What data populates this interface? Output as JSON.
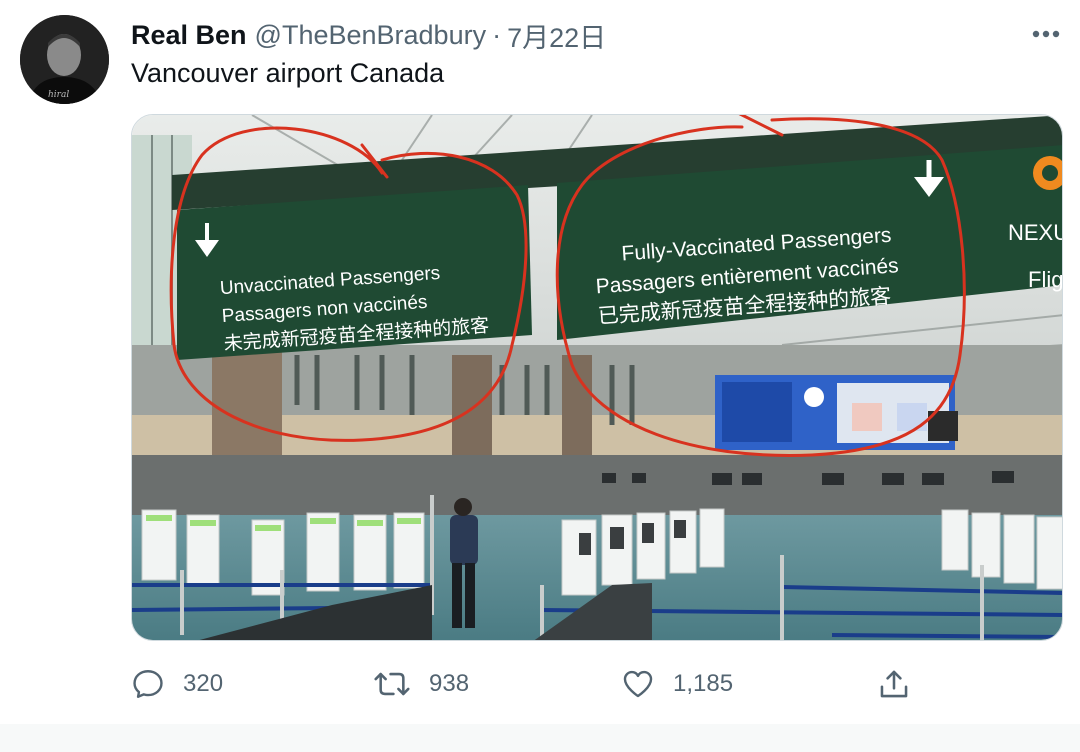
{
  "tweet": {
    "author_name": "Real Ben",
    "author_handle": "@TheBenBradbury",
    "separator": "·",
    "date": "7月22日",
    "text": "Vancouver airport Canada",
    "avatar_icon": "profile-photo",
    "more_icon": "more-dots-icon"
  },
  "photo": {
    "sign_left": {
      "line1": "Unvaccinated Passengers",
      "line2": "Passagers non vaccinés",
      "line3": "未完成新冠疫苗全程接种的旅客"
    },
    "sign_right": {
      "line1": "Fully-Vaccinated Passengers",
      "line2": "Passagers entièrement vaccinés",
      "line3": "已完成新冠疫苗全程接种的旅客"
    },
    "sign_edge": {
      "line1": "NEXU",
      "line2": "Flig"
    },
    "colors": {
      "sign_green": "#1f4a33",
      "annotation_red": "#d8321f",
      "floor": "#5d8d95"
    }
  },
  "actions": {
    "reply_count": "320",
    "retweet_count": "938",
    "like_count": "1,185",
    "reply_icon": "reply-icon",
    "retweet_icon": "retweet-icon",
    "like_icon": "heart-icon",
    "share_icon": "share-icon"
  }
}
